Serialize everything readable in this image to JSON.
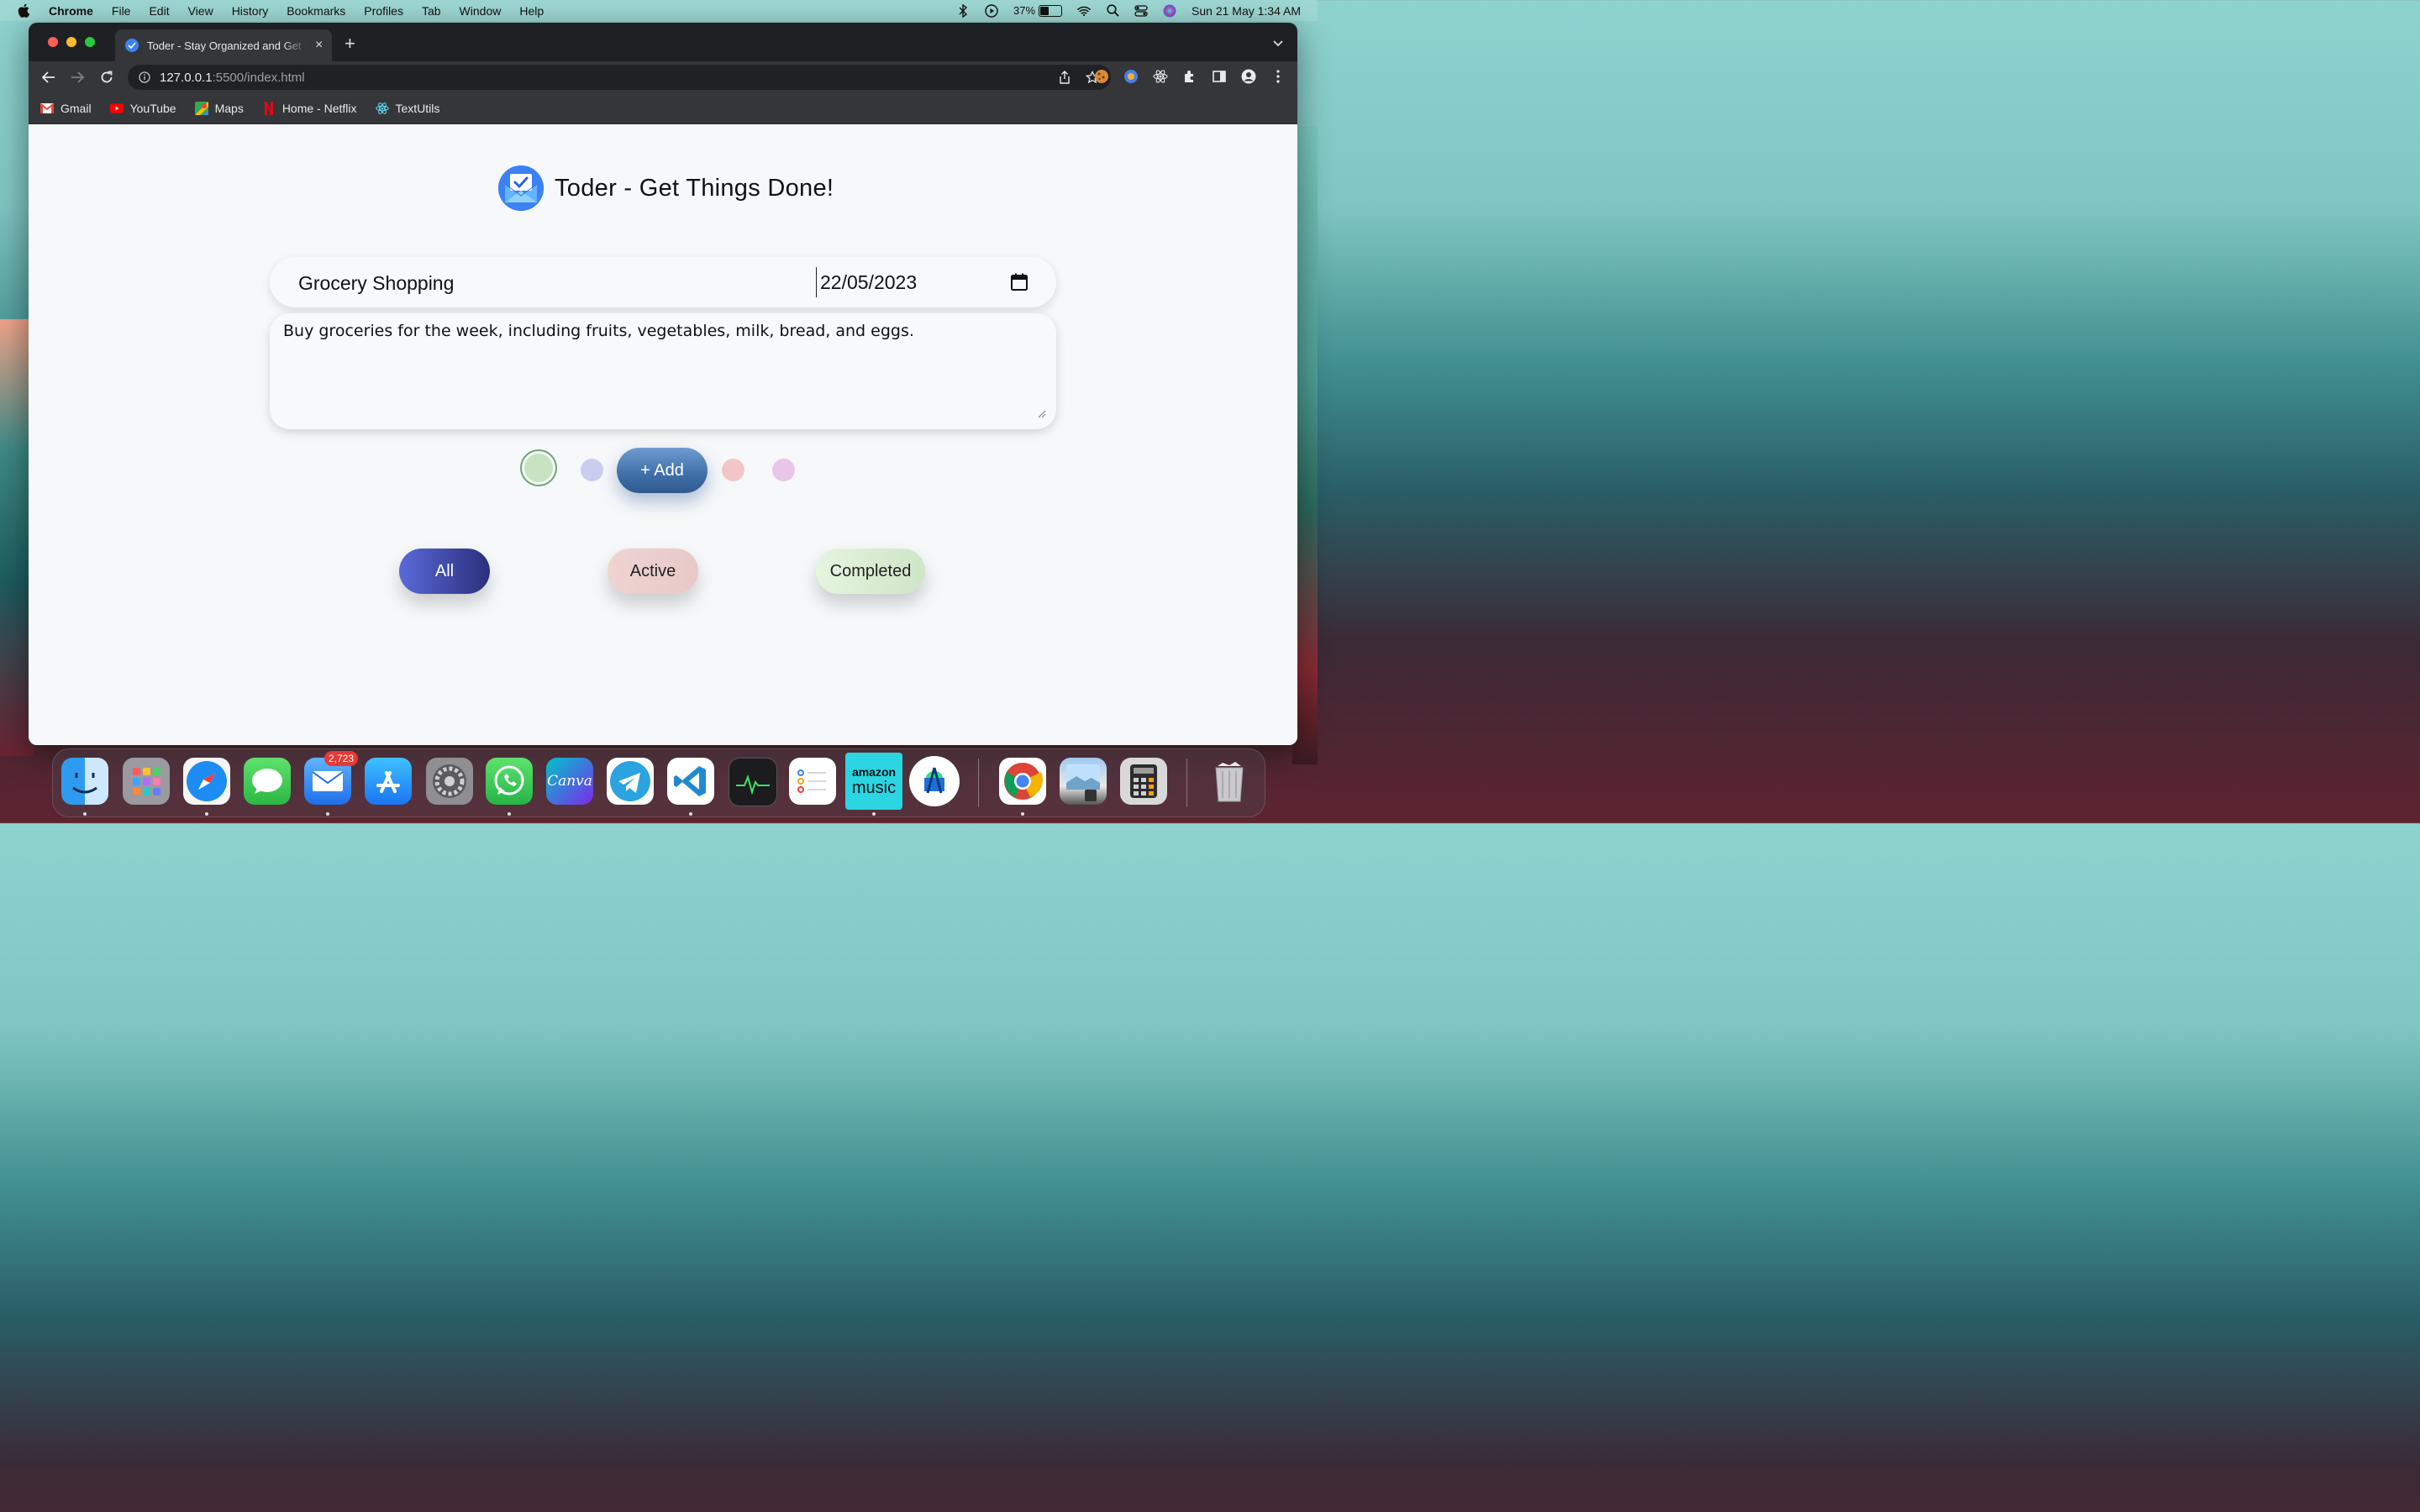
{
  "menubar": {
    "app": "Chrome",
    "items": [
      "File",
      "Edit",
      "View",
      "History",
      "Bookmarks",
      "Profiles",
      "Tab",
      "Window",
      "Help"
    ],
    "battery": "37%",
    "datetime": "Sun 21 May  1:34 AM"
  },
  "browser": {
    "tab_title": "Toder - Stay Organized and Get Things Done",
    "url_host": "127.0.0.1",
    "url_path": ":5500/index.html",
    "bookmarks": [
      {
        "label": "Gmail",
        "icon": "gmail-icon"
      },
      {
        "label": "YouTube",
        "icon": "youtube-icon"
      },
      {
        "label": "Maps",
        "icon": "maps-icon"
      },
      {
        "label": "Home - Netflix",
        "icon": "netflix-icon"
      },
      {
        "label": "TextUtils",
        "icon": "react-icon"
      }
    ]
  },
  "page": {
    "title": "Toder - Get Things Done!",
    "task_name": "Grocery Shopping",
    "task_date": "22/05/2023",
    "task_description": "Buy groceries for the week, including fruits, vegetables, milk, bread, and eggs.",
    "add_label": "+ Add",
    "colors": [
      "#c7e3c0",
      "#c9cdf0",
      "#f3c6c6",
      "#e8c6e8"
    ],
    "selected_color_index": 0,
    "filters": {
      "all": "All",
      "active": "Active",
      "completed": "Completed"
    }
  },
  "dock": {
    "mail_badge": "2,723",
    "apps": [
      "Finder",
      "Launchpad",
      "Safari",
      "Messages",
      "Mail",
      "App Store",
      "System Settings",
      "WhatsApp",
      "Canva",
      "Telegram",
      "Visual Studio Code",
      "Activity Monitor",
      "Reminders",
      "Amazon Music",
      "Android Studio",
      "Chrome",
      "Preview",
      "Calculator",
      "Trash"
    ],
    "canva_label": "Canva",
    "amazon_label_1": "amazon",
    "amazon_label_2": "music"
  }
}
